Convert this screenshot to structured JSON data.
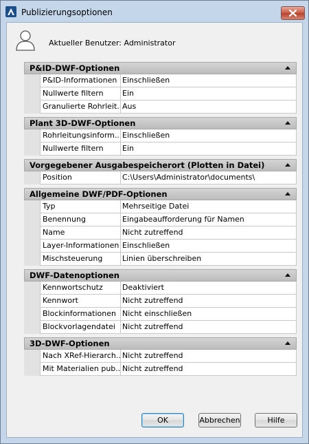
{
  "window": {
    "title": "Publizierungsoptionen"
  },
  "user": {
    "label": "Aktueller Benutzer: Administrator"
  },
  "sections": [
    {
      "title": "P&ID-DWF-Optionen",
      "rows": [
        {
          "key": "P&ID-Informationen",
          "value": "Einschließen"
        },
        {
          "key": "Nullwerte filtern",
          "value": "Ein"
        },
        {
          "key": "Granulierte Rohrleit...",
          "value": "Aus"
        }
      ]
    },
    {
      "title": "Plant 3D-DWF-Optionen",
      "rows": [
        {
          "key": "Rohrleitungsinform...",
          "value": "Einschließen"
        },
        {
          "key": "Nullwerte filtern",
          "value": "Ein"
        }
      ]
    },
    {
      "title": "Vorgegebener Ausgabespeicherort (Plotten in Datei)",
      "rows": [
        {
          "key": "Position",
          "value": "C:\\Users\\Administrator\\documents\\"
        }
      ]
    },
    {
      "title": "Allgemeine DWF/PDF-Optionen",
      "rows": [
        {
          "key": "Typ",
          "value": "Mehrseitige Datei"
        },
        {
          "key": "Benennung",
          "value": "Eingabeaufforderung für Namen"
        },
        {
          "key": "Name",
          "value": "Nicht zutreffend"
        },
        {
          "key": "Layer-Informationen",
          "value": "Einschließen"
        },
        {
          "key": "Mischsteuerung",
          "value": "Linien überschreiben"
        }
      ]
    },
    {
      "title": "DWF-Datenoptionen",
      "rows": [
        {
          "key": "Kennwortschutz",
          "value": "Deaktiviert"
        },
        {
          "key": "Kennwort",
          "value": "Nicht zutreffend"
        },
        {
          "key": "Blockinformationen",
          "value": "Nicht einschließen"
        },
        {
          "key": "Blockvorlagendatei",
          "value": "Nicht zutreffend"
        }
      ]
    },
    {
      "title": "3D-DWF-Optionen",
      "rows": [
        {
          "key": "Nach XRef-Hierarch...",
          "value": "Nicht zutreffend"
        },
        {
          "key": "Mit Materialien pub...",
          "value": "Nicht zutreffend"
        }
      ]
    }
  ],
  "buttons": {
    "ok": "OK",
    "cancel": "Abbrechen",
    "help": "Hilfe"
  }
}
